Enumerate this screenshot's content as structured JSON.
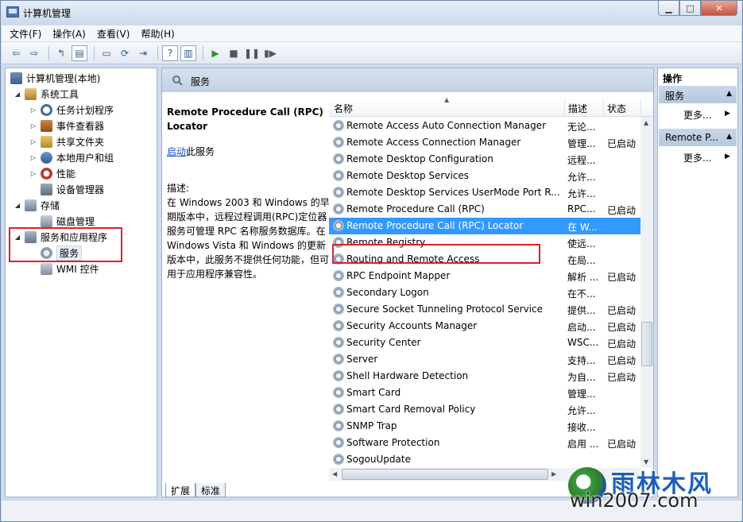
{
  "window": {
    "title": "计算机管理",
    "min_label": "▭",
    "max_label": "□",
    "close_label": "✕"
  },
  "menu": [
    "文件(F)",
    "操作(A)",
    "查看(V)",
    "帮助(H)"
  ],
  "tree": {
    "root": "计算机管理(本地)",
    "system_tools": "系统工具",
    "task_scheduler": "任务计划程序",
    "event_viewer": "事件查看器",
    "shared_folders": "共享文件夹",
    "local_users": "本地用户和组",
    "performance": "性能",
    "device_manager": "设备管理器",
    "storage": "存储",
    "disk_management": "磁盘管理",
    "services_apps": "服务和应用程序",
    "services": "服务",
    "wmi": "WMI 控件"
  },
  "center": {
    "header": "服务",
    "detail_title": "Remote Procedure Call (RPC) Locator",
    "start_link": "启动",
    "start_suffix": "此服务",
    "desc_label": "描述:",
    "description": "在 Windows 2003 和 Windows 的早期版本中，远程过程调用(RPC)定位器服务可管理 RPC 名称服务数据库。在 Windows Vista 和 Windows 的更新版本中，此服务不提供任何功能，但可用于应用程序兼容性。",
    "columns": {
      "name": "名称",
      "description": "描述",
      "status": "状态"
    },
    "services": [
      {
        "name": "Remote Access Auto Connection Manager",
        "description": "无论...",
        "status": ""
      },
      {
        "name": "Remote Access Connection Manager",
        "description": "管理...",
        "status": "已启动"
      },
      {
        "name": "Remote Desktop Configuration",
        "description": "远程...",
        "status": ""
      },
      {
        "name": "Remote Desktop Services",
        "description": "允许...",
        "status": ""
      },
      {
        "name": "Remote Desktop Services UserMode Port R...",
        "description": "允许...",
        "status": ""
      },
      {
        "name": "Remote Procedure Call (RPC)",
        "description": "RPC...",
        "status": "已启动"
      },
      {
        "name": "Remote Procedure Call (RPC) Locator",
        "description": "在 W...",
        "status": ""
      },
      {
        "name": "Remote Registry",
        "description": "使远...",
        "status": ""
      },
      {
        "name": "Routing and Remote Access",
        "description": "在局...",
        "status": ""
      },
      {
        "name": "RPC Endpoint Mapper",
        "description": "解析 ...",
        "status": "已启动"
      },
      {
        "name": "Secondary Logon",
        "description": "在不...",
        "status": ""
      },
      {
        "name": "Secure Socket Tunneling Protocol Service",
        "description": "提供...",
        "status": "已启动"
      },
      {
        "name": "Security Accounts Manager",
        "description": "启动...",
        "status": "已启动"
      },
      {
        "name": "Security Center",
        "description": "WSC...",
        "status": "已启动"
      },
      {
        "name": "Server",
        "description": "支持...",
        "status": "已启动"
      },
      {
        "name": "Shell Hardware Detection",
        "description": "为自...",
        "status": "已启动"
      },
      {
        "name": "Smart Card",
        "description": "管理...",
        "status": ""
      },
      {
        "name": "Smart Card Removal Policy",
        "description": "允许...",
        "status": ""
      },
      {
        "name": "SNMP Trap",
        "description": "接收...",
        "status": ""
      },
      {
        "name": "Software Protection",
        "description": "启用 ...",
        "status": "已启动"
      },
      {
        "name": "SogouUpdate",
        "description": "",
        "status": ""
      }
    ],
    "selected_index": 6,
    "tabs": [
      "扩展",
      "标准"
    ]
  },
  "actions": {
    "title": "操作",
    "groups": [
      {
        "label": "服务",
        "more": "更多..."
      },
      {
        "label": "Remote P...",
        "more": "更多..."
      }
    ]
  },
  "watermark": {
    "title": "雨林木风",
    "url": "win2007.com"
  },
  "colors": {
    "selection": "#3399ff",
    "highlight_box": "#d8232a",
    "link": "#1a4dbf"
  }
}
